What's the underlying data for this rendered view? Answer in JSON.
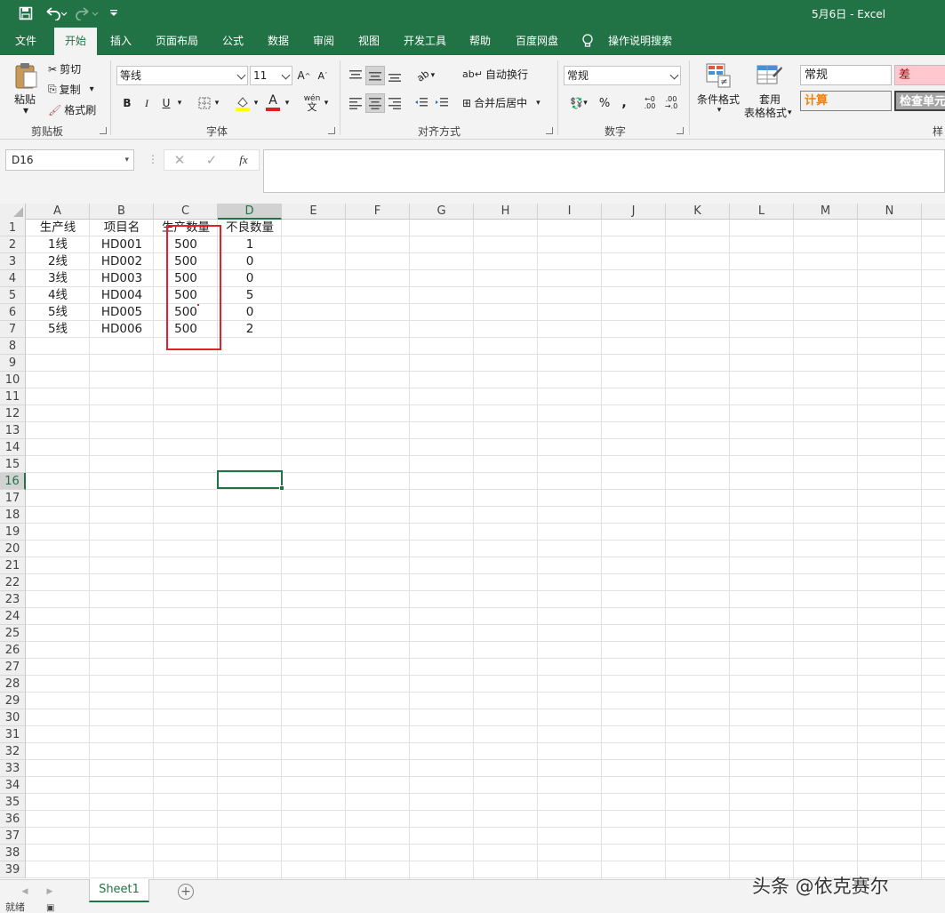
{
  "window": {
    "title": "5月6日  -  Excel"
  },
  "tabs": [
    {
      "label": "文件"
    },
    {
      "label": "开始"
    },
    {
      "label": "插入"
    },
    {
      "label": "页面布局"
    },
    {
      "label": "公式"
    },
    {
      "label": "数据"
    },
    {
      "label": "审阅"
    },
    {
      "label": "视图"
    },
    {
      "label": "开发工具"
    },
    {
      "label": "帮助"
    },
    {
      "label": "百度网盘"
    },
    {
      "label": "操作说明搜索"
    }
  ],
  "ribbon": {
    "clipboard": {
      "paste": "粘贴",
      "cut": "剪切",
      "copy": "复制",
      "format_painter": "格式刷",
      "group": "剪贴板"
    },
    "font": {
      "name": "等线",
      "size": "11",
      "group": "字体"
    },
    "alignment": {
      "wrap": "自动换行",
      "merge": "合并后居中",
      "group": "对齐方式"
    },
    "number": {
      "format": "常规",
      "group": "数字"
    },
    "styles": {
      "conditional": "条件格式",
      "table_format_1": "套用",
      "table_format_2": "表格格式",
      "normal": "常规",
      "bad": "差",
      "calc": "计算",
      "check": "检查单元",
      "group": "样"
    }
  },
  "formula_bar": {
    "name_box": "D16",
    "fx": "fx",
    "content": ""
  },
  "columns": [
    "A",
    "B",
    "C",
    "D",
    "E",
    "F",
    "G",
    "H",
    "I",
    "J",
    "K",
    "L",
    "M",
    "N"
  ],
  "selected": {
    "column": "D",
    "row": 16
  },
  "table": {
    "headers": [
      "生产线",
      "项目名",
      "生产数量",
      "不良数量"
    ],
    "rows": [
      [
        "1线",
        "HD001",
        "500",
        "1"
      ],
      [
        "2线",
        "HD002",
        "500",
        "0"
      ],
      [
        "3线",
        "HD003",
        "500",
        "0"
      ],
      [
        "4线",
        "HD004",
        "500",
        "5"
      ],
      [
        "5线",
        "HD005",
        "500",
        "0"
      ],
      [
        "5线",
        "HD006",
        "500",
        "2"
      ]
    ]
  },
  "sheet_tabs": [
    {
      "label": "Sheet1"
    }
  ],
  "status": {
    "left": "就绪"
  },
  "watermark": "头条 @依克赛尔",
  "colors": {
    "brand": "#217346",
    "highlight_box": "#e0202a"
  }
}
